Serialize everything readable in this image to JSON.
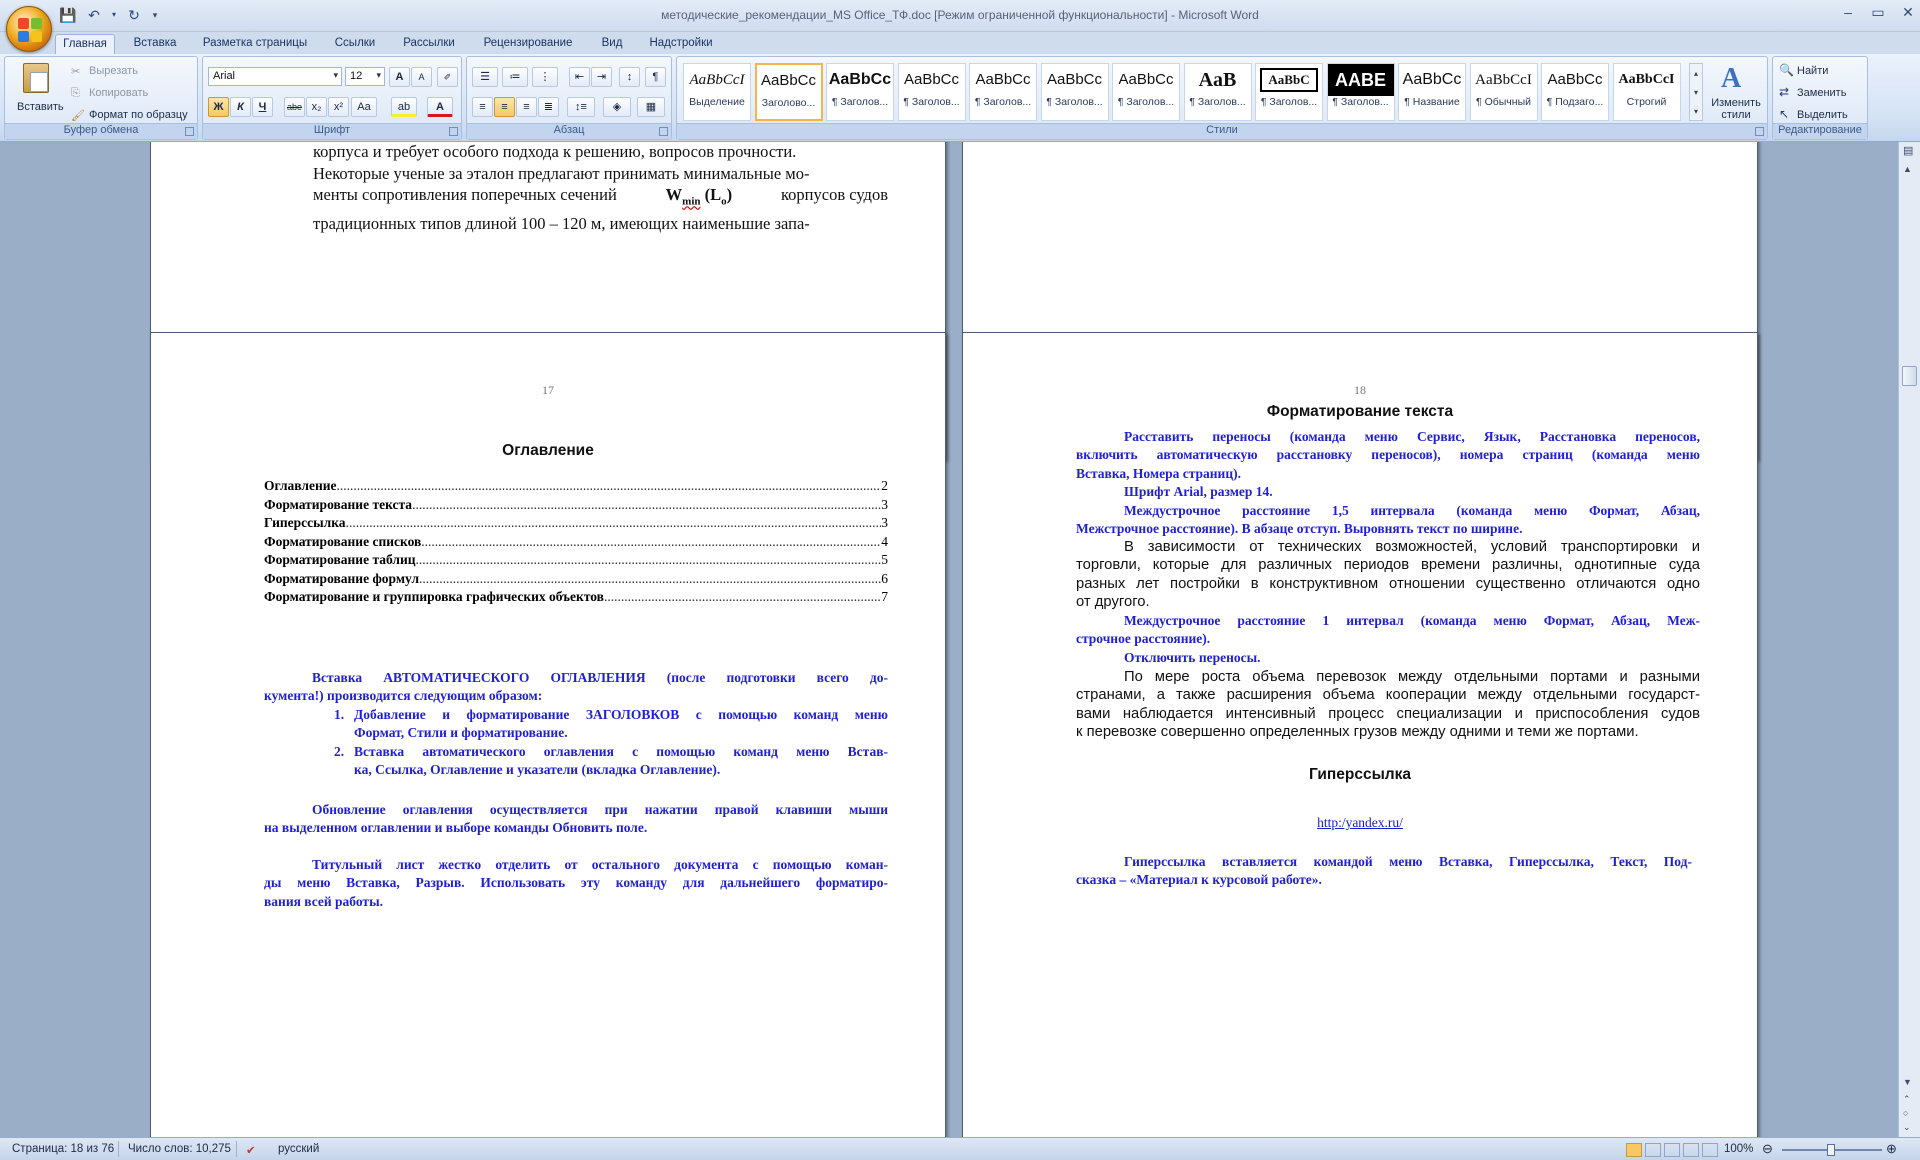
{
  "window": {
    "title": "методические_рекомендации_MS Office_ТФ.doc [Режим ограниченной функциональности] - Microsoft Word",
    "controls": [
      "–",
      "▭",
      "✕"
    ],
    "qat": [
      "save-icon",
      "undo-icon",
      "redo-icon",
      "customize-icon"
    ]
  },
  "tabs": [
    "Главная",
    "Вставка",
    "Разметка страницы",
    "Ссылки",
    "Рассылки",
    "Рецензирование",
    "Вид",
    "Надстройки"
  ],
  "ribbon": {
    "clipboard": {
      "label": "Буфер обмена",
      "paste": "Вставить",
      "cut": "Вырезать",
      "copy": "Копировать",
      "format_painter": "Формат по образцу"
    },
    "font": {
      "label": "Шрифт",
      "font_name": "Arial",
      "font_size": "12",
      "bold": "Ж",
      "italic": "К",
      "underline": "Ч",
      "strike": "abe",
      "sub": "x₂",
      "sup": "x²",
      "case": "Aa",
      "grow": "A",
      "shrink": "A",
      "highlight": "ab",
      "color": "A"
    },
    "paragraph": {
      "label": "Абзац"
    },
    "styles": {
      "label": "Стили",
      "items": [
        {
          "preview": "AaBbCcI",
          "name": "Выделение"
        },
        {
          "preview": "AaBbCc",
          "name": "Заголово..."
        },
        {
          "preview": "AaBbCc",
          "name": "¶ Заголов..."
        },
        {
          "preview": "AaBbCc",
          "name": "¶ Заголов..."
        },
        {
          "preview": "AaBbCc",
          "name": "¶ Заголов..."
        },
        {
          "preview": "AaBbCc",
          "name": "¶ Заголов..."
        },
        {
          "preview": "AaBbCc",
          "name": "¶ Заголов..."
        },
        {
          "preview": "AaB",
          "name": "¶ Заголов..."
        },
        {
          "preview": "AaBbC",
          "name": "¶ Заголов..."
        },
        {
          "preview": "AABE",
          "name": "¶ Заголов..."
        },
        {
          "preview": "AaBbCc",
          "name": "¶ Название"
        },
        {
          "preview": "AaBbCcI",
          "name": "¶ Обычный"
        },
        {
          "preview": "AaBbCc",
          "name": "¶ Подзаго..."
        },
        {
          "preview": "AaBbCcI",
          "name": "Строгий"
        }
      ],
      "change_styles": "Изменить стили"
    },
    "editing": {
      "label": "Редактирование",
      "find": "Найти",
      "replace": "Заменить",
      "select": "Выделить"
    }
  },
  "pages": {
    "top_left": {
      "lines": [
        "корпуса и требует особого подхода к решению, вопросов прочности.",
        "Некоторые ученые за эталон предлагают принимать минимальные мо-",
        "менты сопротивления поперечных сечений",
        "корпусов судов",
        "традиционных типов длиной 100 – 120 м, имеющих наименьшие запа-"
      ],
      "w": "W",
      "w_sub": "min",
      "l": "(L",
      "l_sub": "o",
      ")": ")"
    },
    "p17": {
      "number": "17",
      "heading": "Оглавление",
      "toc": [
        {
          "title": "Оглавление",
          "page": "2"
        },
        {
          "title": "Форматирование текста",
          "page": "3"
        },
        {
          "title": "Гиперссылка",
          "page": "3"
        },
        {
          "title": "Форматирование списков",
          "page": "4"
        },
        {
          "title": "Форматирование таблиц",
          "page": "5"
        },
        {
          "title": "Форматирование формул",
          "page": "6"
        },
        {
          "title": "Форматирование и группировка графических объектов",
          "page": "7"
        }
      ],
      "intro_l1": "Вставка АВТОМАТИЧЕСКОГО ОГЛАВЛЕНИЯ (после подготовки всего до-",
      "intro_l2": "кумента!) производится следующим образом:",
      "list": [
        {
          "n": "1.",
          "l1": "Добавление и форматирование ЗАГОЛОВКОВ с помощью команд меню",
          "l2": "Формат, Стили и форматирование."
        },
        {
          "n": "2.",
          "l1": "Вставка автоматического оглавления с помощью команд меню Встав-",
          "l2": "ка, Ссылка, Оглавление и указатели (вкладка Оглавление)."
        }
      ],
      "update_l1": "Обновление оглавления осуществляется при нажатии правой клавиши мыши",
      "update_l2": "на выделенном оглавлении и  выборе команды Обновить поле.",
      "title_l1": "Титульный лист жестко отделить от остального документа с помощью коман-",
      "title_l2": "ды меню Вставка, Разрыв. Использовать эту команду для дальнейшего форматиро-",
      "title_l3": "вания всей работы."
    },
    "p18": {
      "number": "18",
      "heading": "Форматирование текста",
      "b1_l1": "Расставить переносы (команда меню Сервис, Язык, Расстановка переносов,",
      "b1_l2": "включить автоматическую расстановку переносов), номера страниц (команда меню",
      "b1_l3": "Вставка, Номера страниц).",
      "b2": "Шрифт Arial, размер 14.",
      "b3_l1": "Междустрочное расстояние 1,5 интервала (команда меню Формат, Абзац,",
      "b3_l2": "Межстрочное расстояние). В абзаце отступ. Выровнять текст по ширине.",
      "p1_l1": "В зависимости от технических возможностей, условий транспортировки и",
      "p1_l2": "торговли, которые для различных периодов времени различны, однотипные суда",
      "p1_l3": "разных лет постройки в конструктивном отношении существенно отличаются одно",
      "p1_l4": "от другого.",
      "b4_l1": "Междустрочное расстояние 1 интервал (команда меню Формат, Абзац, Меж-",
      "b4_l2": "строчное расстояние).",
      "b5": "Отключить переносы.",
      "p2_l1": "По мере роста объема перевозок между отдельными портами и разными",
      "p2_l2": "странами, а также расширения объема кооперации между отдельными государст-",
      "p2_l3": "вами наблюдается интенсивный процесс специализации и приспособления судов",
      "p2_l4": "к перевозке совершенно определенных грузов между одними и теми же портами.",
      "h2": "Гиперссылка",
      "link": "http:/yandex.ru/",
      "b6_l1": "Гиперссылка вставляется командой меню Вставка, Гиперссылка, Текст, Под-",
      "b6_l2": "сказка – «Материал к курсовой работе»."
    }
  },
  "status": {
    "page": "Страница: 18 из 76",
    "words": "Число слов: 10,275",
    "lang": "русский",
    "zoom": "100%"
  },
  "colors": {
    "accent_blue": "#1f1fd4",
    "ribbon": "#dae6f6",
    "doc_bg": "#9aaec7"
  }
}
